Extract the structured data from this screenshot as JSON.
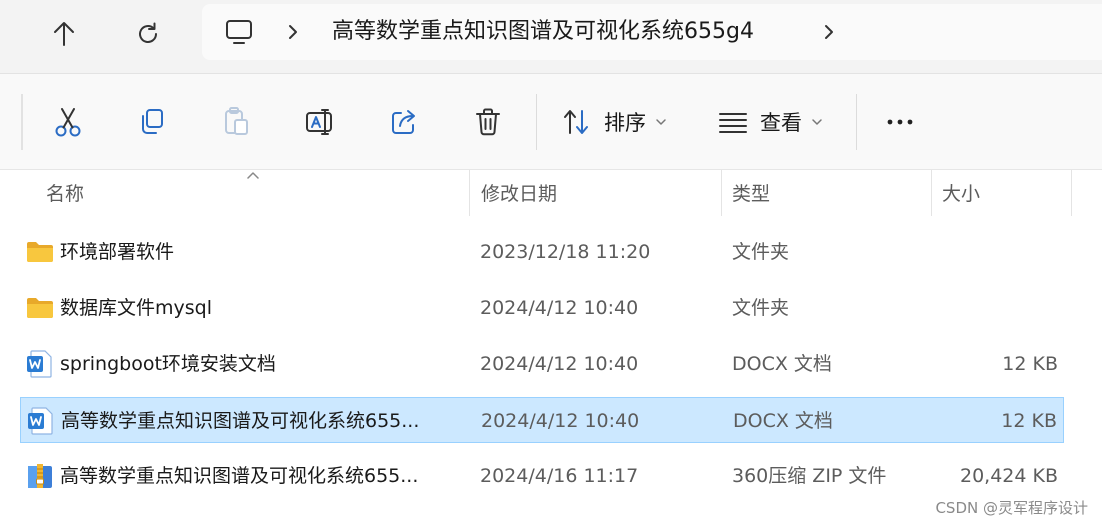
{
  "address_bar": {
    "path": "高等数学重点知识图谱及可视化系统655g4"
  },
  "toolbar": {
    "sort_label": "排序",
    "view_label": "查看"
  },
  "columns": {
    "name": "名称",
    "date": "修改日期",
    "type": "类型",
    "size": "大小"
  },
  "rows": [
    {
      "icon": "folder-icon",
      "name": "环境部署软件",
      "date": "2023/12/18 11:20",
      "type": "文件夹",
      "size": ""
    },
    {
      "icon": "folder-icon",
      "name": "数据库文件mysql",
      "date": "2024/4/12 10:40",
      "type": "文件夹",
      "size": ""
    },
    {
      "icon": "word-doc-icon",
      "name": "springboot环境安装文档",
      "date": "2024/4/12 10:40",
      "type": "DOCX 文档",
      "size": "12 KB"
    },
    {
      "icon": "word-doc-icon",
      "name": "高等数学重点知识图谱及可视化系统655...",
      "date": "2024/4/12 10:40",
      "type": "DOCX 文档",
      "size": "12 KB",
      "selected": true
    },
    {
      "icon": "zip-archive-icon",
      "name": "高等数学重点知识图谱及可视化系统655...",
      "date": "2024/4/16 11:17",
      "type": "360压缩 ZIP 文件",
      "size": "20,424 KB"
    }
  ],
  "watermark": "CSDN @灵军程序设计",
  "colors": {
    "selection_bg": "#cce8ff",
    "selection_border": "#99d1ff",
    "folder": "#f8c73e",
    "word": "#2b7cd3",
    "accent": "#0067c0"
  }
}
